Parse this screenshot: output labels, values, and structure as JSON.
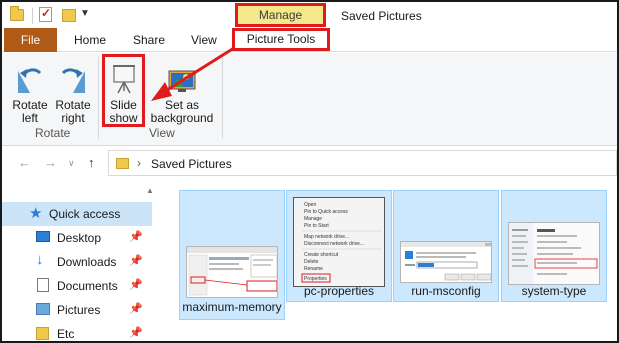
{
  "titlebar": {
    "manage_label": "Manage",
    "window_title": "Saved Pictures"
  },
  "tabs": {
    "file": "File",
    "home": "Home",
    "share": "Share",
    "view": "View",
    "picture_tools": "Picture Tools"
  },
  "ribbon": {
    "rotate_left": [
      "Rotate",
      "left"
    ],
    "rotate_right": [
      "Rotate",
      "right"
    ],
    "rotate_group": "Rotate",
    "slide_show": [
      "Slide",
      "show"
    ],
    "set_as_background": [
      "Set as",
      "background"
    ],
    "view_group": "View"
  },
  "address": {
    "path": "Saved Pictures"
  },
  "nav_pane": {
    "items": [
      {
        "label": "Quick access",
        "icon": "star-icon",
        "pinned": false
      },
      {
        "label": "Desktop",
        "icon": "desktop-icon",
        "pinned": true
      },
      {
        "label": "Downloads",
        "icon": "download-icon",
        "pinned": true
      },
      {
        "label": "Documents",
        "icon": "document-icon",
        "pinned": true
      },
      {
        "label": "Pictures",
        "icon": "pictures-icon",
        "pinned": true
      },
      {
        "label": "Etc",
        "icon": "folder-icon",
        "pinned": true
      }
    ]
  },
  "files": [
    {
      "name": "maximum-memory"
    },
    {
      "name": "pc-properties"
    },
    {
      "name": "run-msconfig"
    },
    {
      "name": "system-type"
    }
  ],
  "context_menu": {
    "items": [
      "Open",
      "Pin to Quick access",
      "Manage",
      "Pin to Start",
      "Map network drive...",
      "Disconnect network drive...",
      "Create shortcut",
      "Delete",
      "Rename",
      "Properties"
    ]
  },
  "colors": {
    "annotation": "#e01b1b",
    "file_tab": "#b05a18",
    "manage_tab": "#f3e88a",
    "selection": "#cce8ff"
  }
}
